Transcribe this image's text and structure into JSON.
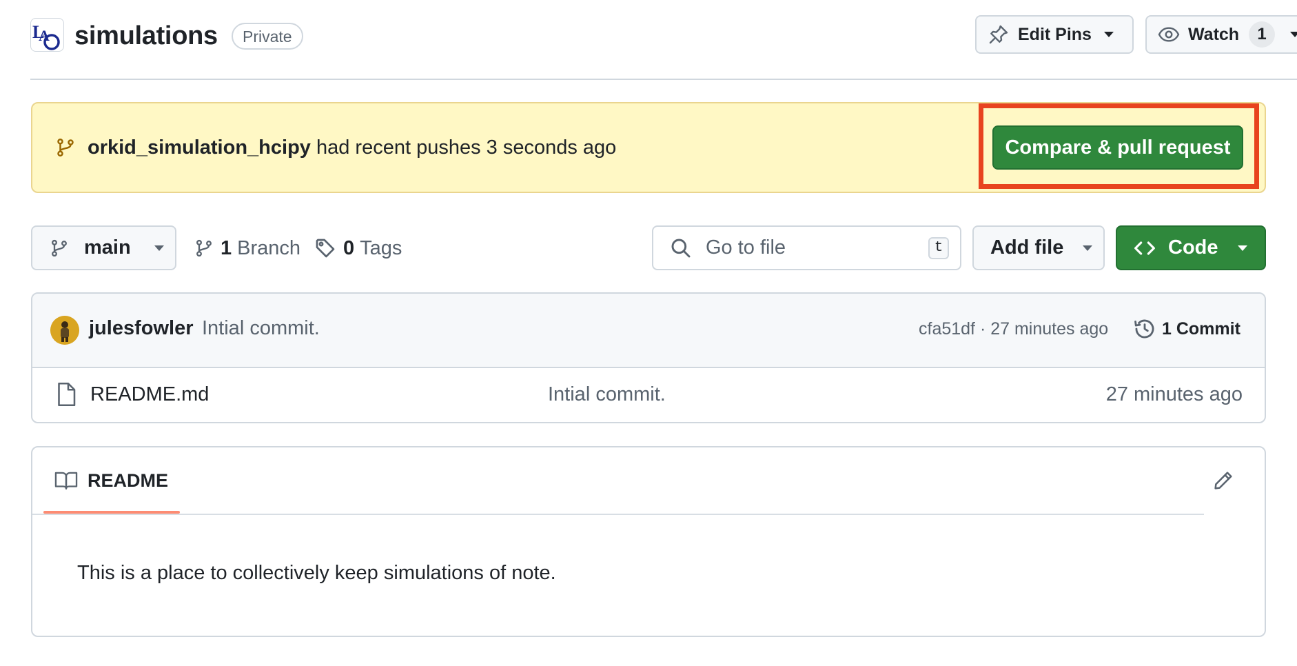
{
  "repo": {
    "name": "simulations",
    "visibility": "Private",
    "edit_pins_label": "Edit Pins",
    "watch_label": "Watch",
    "watch_count": "1"
  },
  "banner": {
    "branch": "orkid_simulation_hcipy",
    "message": "had recent pushes 3 seconds ago",
    "compare_button": "Compare & pull request"
  },
  "toolbar": {
    "branch": "main",
    "branch_count": "1",
    "branch_label": "Branch",
    "tag_count": "0",
    "tag_label": "Tags",
    "search_placeholder": "Go to file",
    "search_shortcut": "t",
    "add_file_label": "Add file",
    "code_label": "Code"
  },
  "latest_commit": {
    "user": "julesfowler",
    "message": "Intial commit.",
    "meta": "cfa51df · 27 minutes ago",
    "commit_count_label": "1 Commit"
  },
  "files": [
    {
      "name": "README.md",
      "message": "Intial commit.",
      "time": "27 minutes ago"
    }
  ],
  "readme": {
    "tab_label": "README",
    "content": "This is a place to collectively keep simulations of note."
  },
  "colors": {
    "primary_green": "#2f883c",
    "banner_bg": "#fff8c5",
    "highlight_red": "#e8431f",
    "tab_underline": "#fd8c73"
  }
}
